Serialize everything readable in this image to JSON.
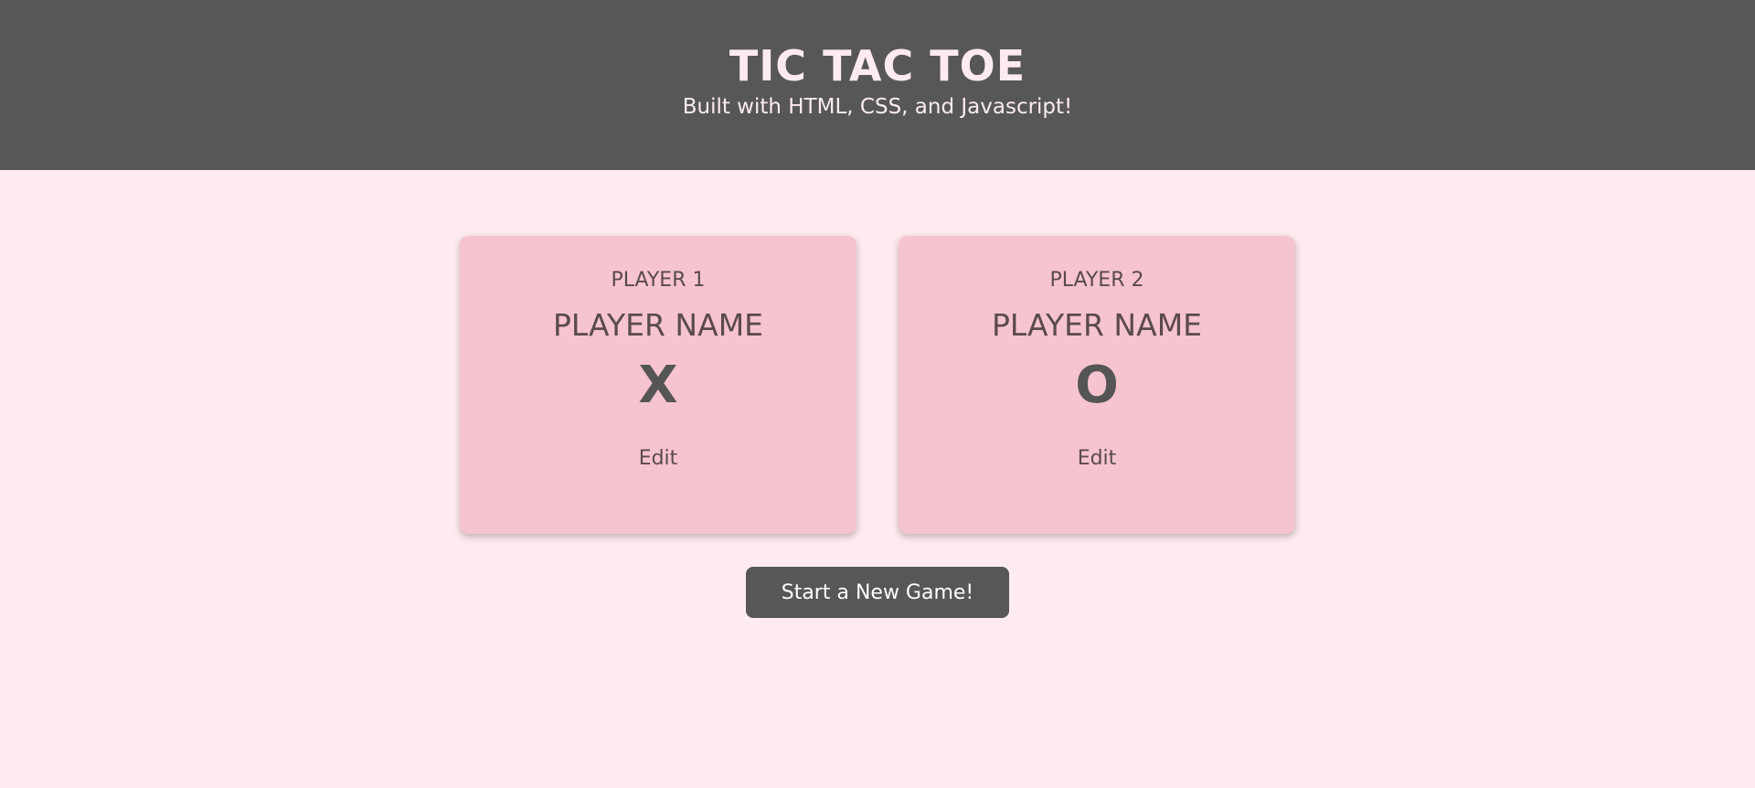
{
  "header": {
    "title": "TIC TAC TOE",
    "subtitle": "Built with HTML, CSS, and Javascript!"
  },
  "players": [
    {
      "label": "PLAYER 1",
      "name": "PLAYER NAME",
      "symbol": "X",
      "edit_label": "Edit"
    },
    {
      "label": "PLAYER 2",
      "name": "PLAYER NAME",
      "symbol": "O",
      "edit_label": "Edit"
    }
  ],
  "actions": {
    "start_label": "Start a New Game!"
  },
  "colors": {
    "header_bg": "#575757",
    "page_bg": "#fdebef",
    "card_bg": "#f6c4ce",
    "text_dark": "#555555",
    "button_bg": "#575757",
    "button_text": "#ffffff"
  }
}
